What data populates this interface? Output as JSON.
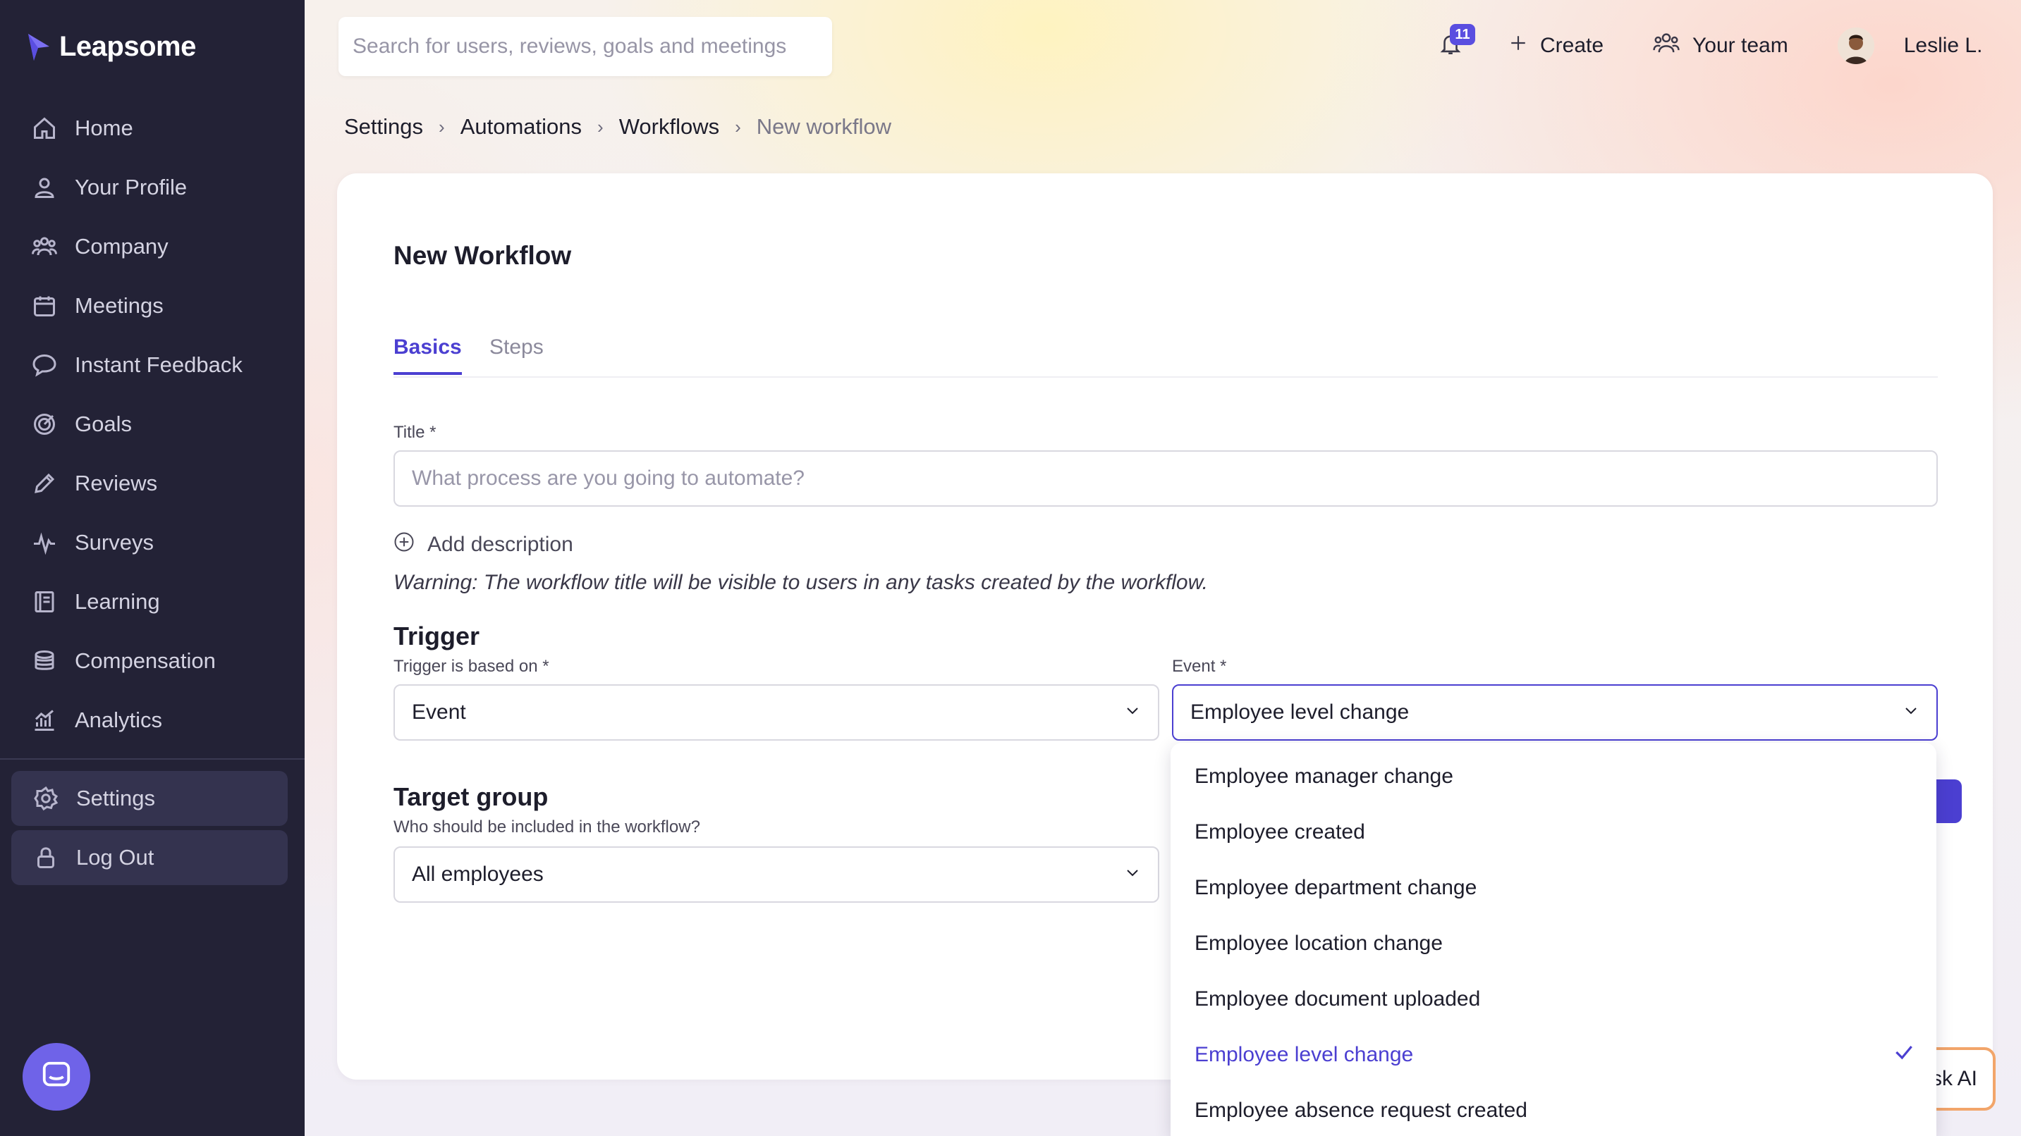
{
  "brand": {
    "name": "Leapsome",
    "accent": "#4b3fd1",
    "sidebar_bg": "#232236"
  },
  "sidebar": {
    "items": [
      {
        "label": "Home",
        "icon": "home-icon"
      },
      {
        "label": "Your Profile",
        "icon": "user-icon"
      },
      {
        "label": "Company",
        "icon": "users-icon"
      },
      {
        "label": "Meetings",
        "icon": "calendar-icon"
      },
      {
        "label": "Instant Feedback",
        "icon": "chat-icon"
      },
      {
        "label": "Goals",
        "icon": "target-icon"
      },
      {
        "label": "Reviews",
        "icon": "pencil-icon"
      },
      {
        "label": "Surveys",
        "icon": "pulse-icon"
      },
      {
        "label": "Learning",
        "icon": "book-icon"
      },
      {
        "label": "Compensation",
        "icon": "coins-icon"
      },
      {
        "label": "Analytics",
        "icon": "chart-icon"
      }
    ],
    "bottom": [
      {
        "label": "Settings",
        "icon": "gear-icon"
      },
      {
        "label": "Log Out",
        "icon": "lock-icon"
      }
    ]
  },
  "topbar": {
    "search_placeholder": "Search for users, reviews, goals and meetings",
    "notifications_count": "11",
    "create_label": "Create",
    "team_label": "Your team",
    "user_name": "Leslie L."
  },
  "breadcrumb": [
    "Settings",
    "Automations",
    "Workflows",
    "New workflow"
  ],
  "form": {
    "title": "New Workflow",
    "tabs": [
      "Basics",
      "Steps"
    ],
    "title_label": "Title *",
    "title_placeholder": "What process are you going to automate?",
    "title_value": "",
    "add_description": "Add description",
    "warning": "Warning: The workflow title will be visible to users in any tasks created by the workflow.",
    "trigger": {
      "heading": "Trigger",
      "based_on_label": "Trigger is based on *",
      "based_on_value": "Event",
      "event_label": "Event *",
      "event_value": "Employee level change"
    },
    "target": {
      "heading": "Target group",
      "subtitle": "Who should be included in the workflow?",
      "value": "All employees"
    }
  },
  "event_options": [
    {
      "label": "Employee manager change",
      "selected": false
    },
    {
      "label": "Employee created",
      "selected": false
    },
    {
      "label": "Employee department change",
      "selected": false
    },
    {
      "label": "Employee location change",
      "selected": false
    },
    {
      "label": "Employee document uploaded",
      "selected": false
    },
    {
      "label": "Employee level change",
      "selected": true
    },
    {
      "label": "Employee absence request created",
      "selected": false
    }
  ],
  "ask_ai_label": "sk AI"
}
